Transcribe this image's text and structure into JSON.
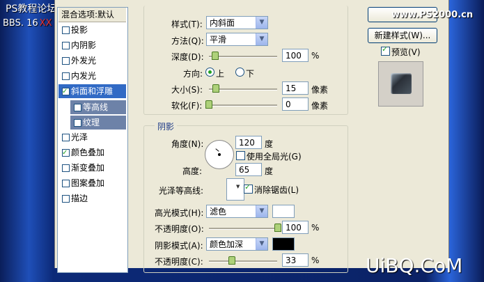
{
  "watermarks": {
    "site_top_left": "PS教程论坛",
    "bbs": "BBS. 16",
    "bbs_mid": "XX",
    "site_top_right": "www.PS2000.cn",
    "site_bottom_right": "UiBQ.CoM"
  },
  "style_list": {
    "header": "混合选项:默认",
    "items": [
      {
        "label": "投影",
        "checked": false
      },
      {
        "label": "内阴影",
        "checked": false
      },
      {
        "label": "外发光",
        "checked": false
      },
      {
        "label": "内发光",
        "checked": false
      },
      {
        "label": "斜面和浮雕",
        "checked": true,
        "selected": true
      },
      {
        "label": "等高线",
        "checked": false,
        "sub": true
      },
      {
        "label": "纹理",
        "checked": false,
        "sub": true
      },
      {
        "label": "光泽",
        "checked": false
      },
      {
        "label": "颜色叠加",
        "checked": true
      },
      {
        "label": "渐变叠加",
        "checked": false
      },
      {
        "label": "图案叠加",
        "checked": false
      },
      {
        "label": "描边",
        "checked": false
      }
    ]
  },
  "structure": {
    "style_label": "样式(T):",
    "style_value": "内斜面",
    "technique_label": "方法(Q):",
    "technique_value": "平滑",
    "depth_label": "深度(D):",
    "depth_value": "100",
    "depth_unit": "%",
    "depth_level": 1.0,
    "direction_label": "方向:",
    "direction_up": "上",
    "direction_down": "下",
    "direction_selected": "上",
    "size_label": "大小(S):",
    "size_value": "15",
    "size_unit": "像素",
    "soften_label": "软化(F):",
    "soften_value": "0",
    "soften_unit": "像素"
  },
  "shading": {
    "title": "阴影",
    "angle_label": "角度(N):",
    "angle_value": "120",
    "angle_unit": "度",
    "global_light_label": "使用全局光(G)",
    "global_light_checked": false,
    "altitude_label": "高度:",
    "altitude_value": "65",
    "altitude_unit": "度",
    "gloss_contour_label": "光泽等高线:",
    "anti_alias_label": "消除锯齿(L)",
    "anti_alias_checked": true,
    "highlight_mode_label": "高光模式(H):",
    "highlight_mode_value": "滤色",
    "highlight_color": "#ffffff",
    "highlight_opacity_label": "不透明度(O):",
    "highlight_opacity_value": "100",
    "highlight_opacity_unit": "%",
    "shadow_mode_label": "阴影模式(A):",
    "shadow_mode_value": "颜色加深",
    "shadow_color": "#000000",
    "shadow_opacity_label": "不透明度(C):",
    "shadow_opacity_value": "33",
    "shadow_opacity_unit": "%"
  },
  "right_panel": {
    "new_style_button": "新建样式(W)...",
    "preview_label": "预览(V)",
    "preview_checked": true
  }
}
